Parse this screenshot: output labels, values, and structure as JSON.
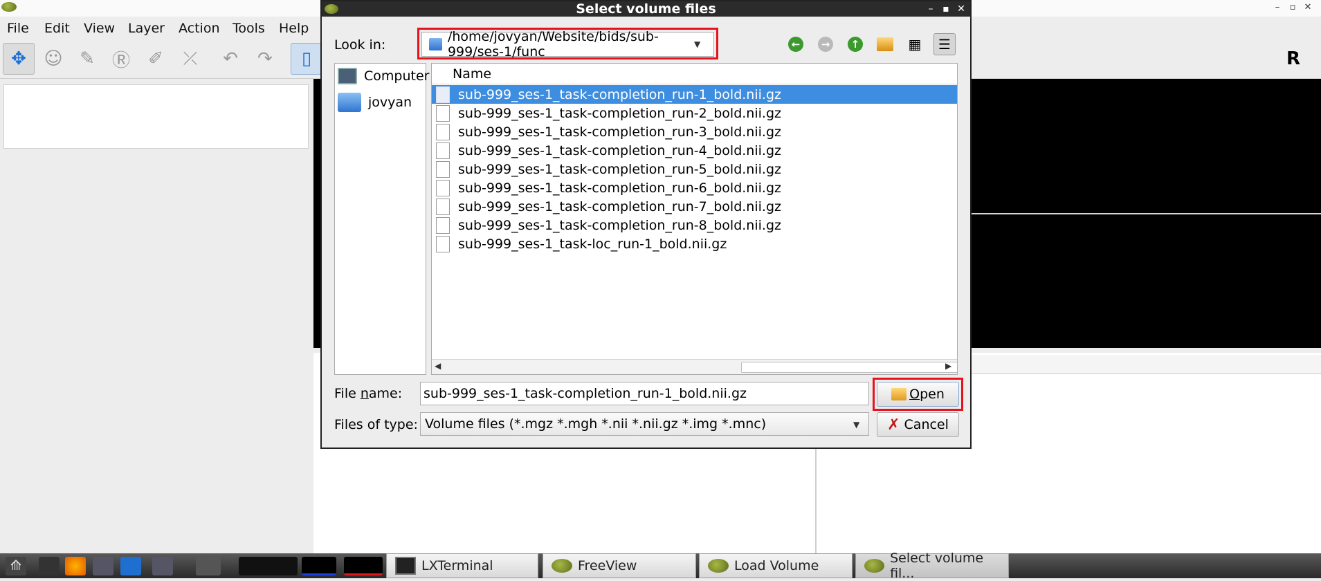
{
  "app": {
    "menu": [
      "File",
      "Edit",
      "View",
      "Layer",
      "Action",
      "Tools",
      "Help"
    ],
    "orientation_label": "R"
  },
  "dialog": {
    "title": "Select volume files",
    "look_in_label": "Look in:",
    "look_in_path": "/home/jovyan/Website/bids/sub-999/ses-1/func",
    "sidebar": [
      "Computer",
      "jovyan"
    ],
    "column_header": "Name",
    "files": [
      "sub-999_ses-1_task-completion_run-1_bold.nii.gz",
      "sub-999_ses-1_task-completion_run-2_bold.nii.gz",
      "sub-999_ses-1_task-completion_run-3_bold.nii.gz",
      "sub-999_ses-1_task-completion_run-4_bold.nii.gz",
      "sub-999_ses-1_task-completion_run-5_bold.nii.gz",
      "sub-999_ses-1_task-completion_run-6_bold.nii.gz",
      "sub-999_ses-1_task-completion_run-7_bold.nii.gz",
      "sub-999_ses-1_task-completion_run-8_bold.nii.gz",
      "sub-999_ses-1_task-loc_run-1_bold.nii.gz"
    ],
    "selected_index": 0,
    "file_name_label_pre": "File ",
    "file_name_label_u": "n",
    "file_name_label_post": "ame:",
    "file_name_value": "sub-999_ses-1_task-completion_run-1_bold.nii.gz",
    "files_of_type_label": "Files of type:",
    "files_of_type_value": "Volume files (*.mgz *.mgh *.nii *.nii.gz *.img *.mnc)",
    "open_u": "O",
    "open_rest": "pen",
    "cancel_label": "Cancel"
  },
  "taskbar": {
    "tasks": [
      "LXTerminal",
      "FreeView",
      "Load Volume",
      "Select volume fil..."
    ]
  },
  "colors": {
    "highlight": "#e8121c",
    "selection": "#3d8ee0"
  }
}
